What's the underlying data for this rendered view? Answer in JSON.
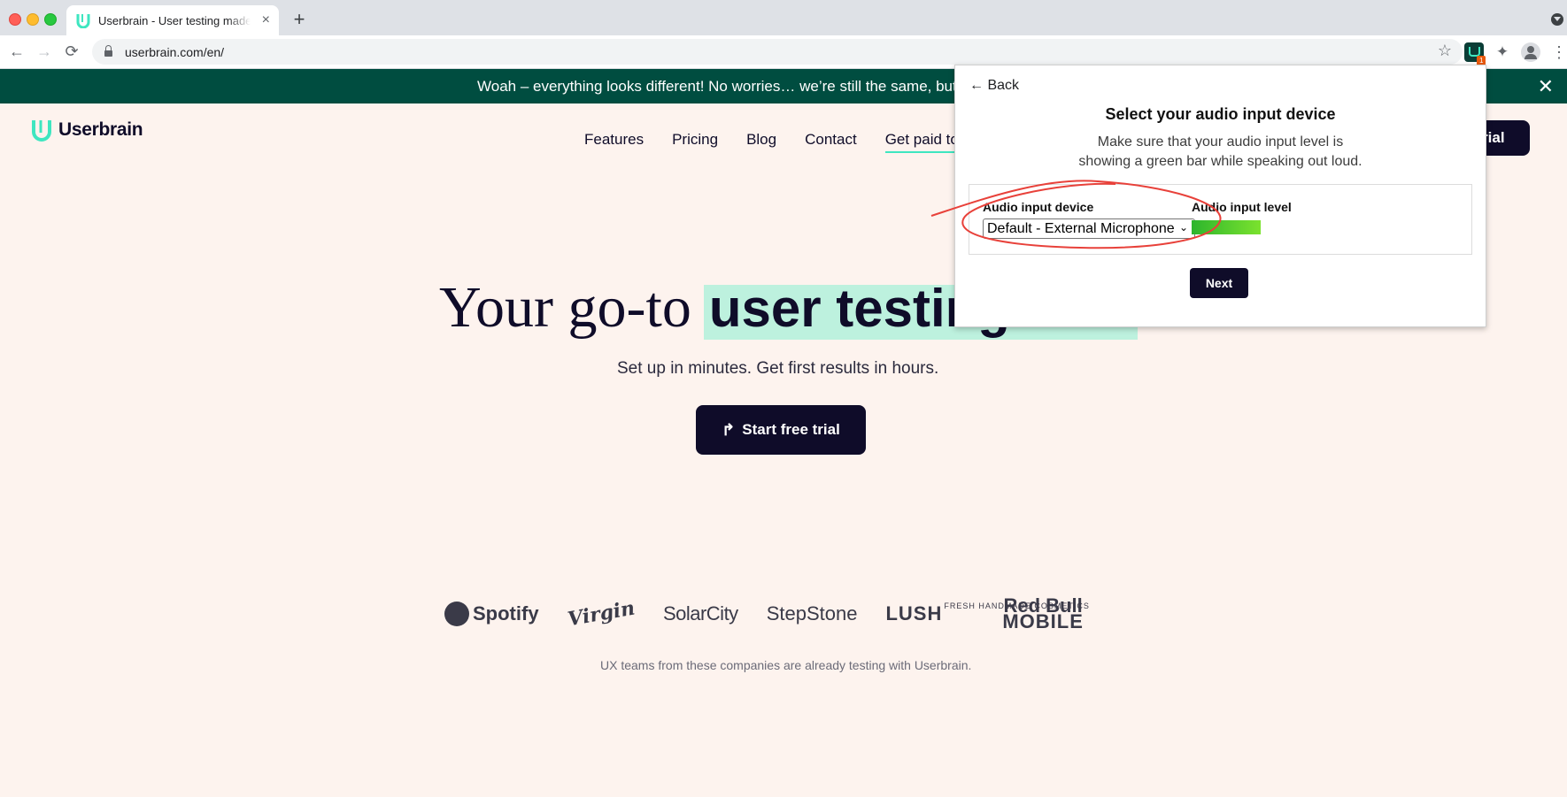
{
  "browser": {
    "tab_title": "Userbrain - User testing made easy",
    "tab_close": "×",
    "new_tab": "+",
    "url": "userbrain.com/en/",
    "back": "←",
    "forward": "→",
    "reload": "⟳",
    "star": "☆",
    "ext_badge": "1",
    "puzzle": "✦",
    "menu": "⋮"
  },
  "banner": {
    "text": "Woah – everything looks different! No worries… we’re still the same, but b",
    "close": "✕"
  },
  "site": {
    "logo": "Userbrain",
    "nav": [
      "Features",
      "Pricing",
      "Blog",
      "Contact",
      "Get paid to"
    ],
    "trial_top": "trial",
    "hero_plain": "Your go-to",
    "hero_highlight": "user testing",
    "subtitle": "Set up in minutes. Get first results in hours.",
    "cta": "Start free trial",
    "cta_icon": "↱",
    "logos": {
      "spotify": "Spotify",
      "virgin": "Virgin",
      "solarcity": "SolarCity",
      "stepstone": "StepStone",
      "lush": "LUSH",
      "lush_small": "FRESH HANDMADE COSMETICS",
      "redbull": "Red Bull",
      "mobile": "MOBILE"
    },
    "trust": "UX teams from these companies are already testing with Userbrain."
  },
  "popup": {
    "back": "← Back",
    "title": "Select your audio input device",
    "desc_line1": "Make sure that your audio input level is",
    "desc_line2": "showing a green bar while speaking out loud.",
    "device_label": "Audio input device",
    "device_value": "Default - External Microphone",
    "level_label": "Audio input level",
    "next": "Next"
  },
  "colors": {
    "banner": "#004d40",
    "accent": "#3ee6c0",
    "dark": "#0f0c29",
    "annotation": "#e8413a"
  }
}
